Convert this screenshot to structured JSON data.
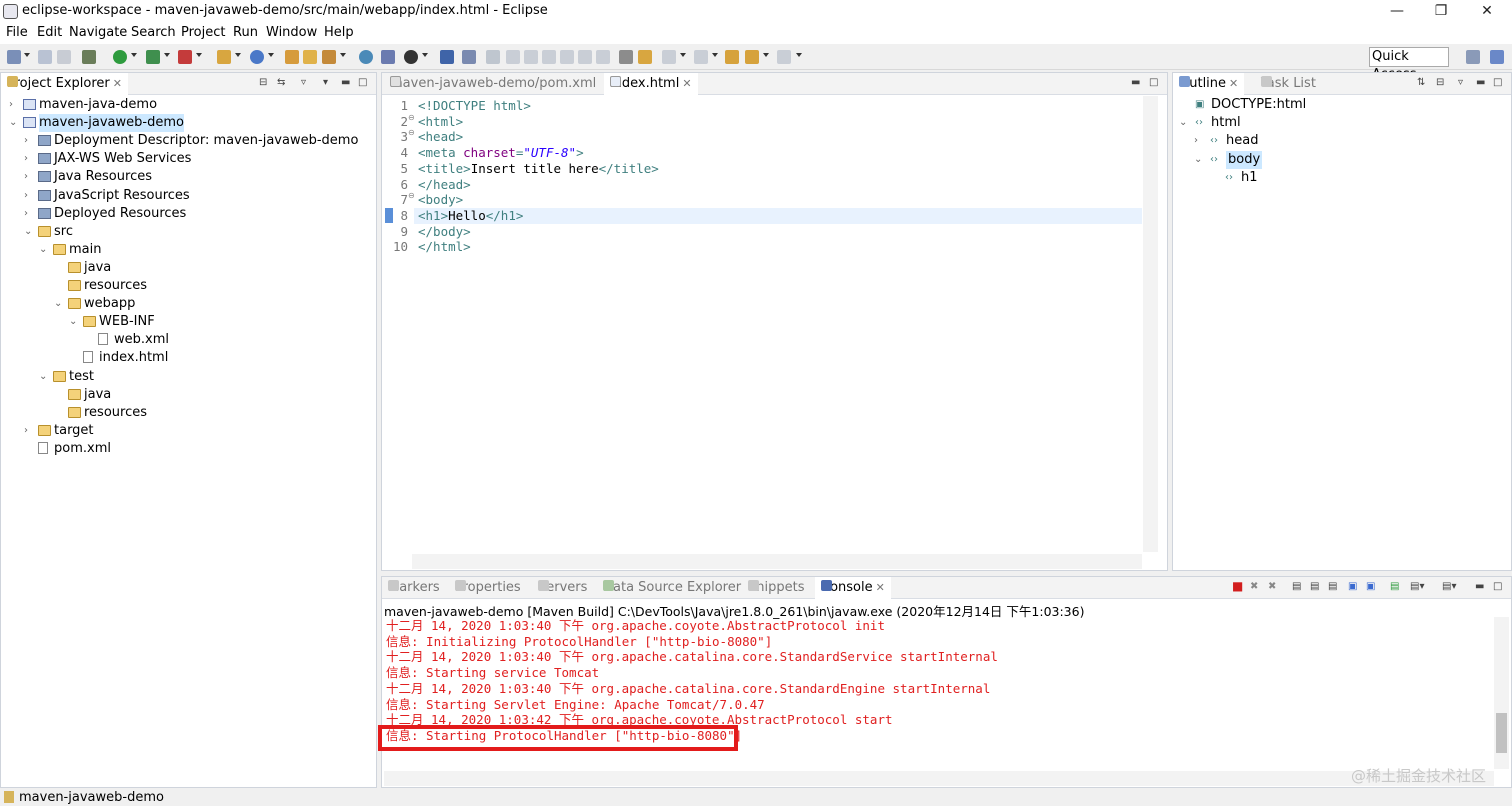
{
  "window": {
    "title": "eclipse-workspace - maven-javaweb-demo/src/main/webapp/index.html - Eclipse",
    "minimize": "—",
    "restore": "❐",
    "close": "✕"
  },
  "menu": [
    "File",
    "Edit",
    "Navigate",
    "Search",
    "Project",
    "Run",
    "Window",
    "Help"
  ],
  "toolbar": {
    "quick_access": "Quick Access"
  },
  "project_explorer": {
    "tab_label": "Project Explorer",
    "tree": [
      {
        "label": "maven-java-demo",
        "icon": "project-icon",
        "depth": 0,
        "twisty": "collapsed"
      },
      {
        "label": "maven-javaweb-demo",
        "icon": "project-icon",
        "depth": 0,
        "twisty": "expanded",
        "selected": true
      },
      {
        "label": "Deployment Descriptor: maven-javaweb-demo",
        "icon": "descriptor-icon",
        "depth": 1,
        "twisty": "collapsed"
      },
      {
        "label": "JAX-WS Web Services",
        "icon": "webservice-icon",
        "depth": 1,
        "twisty": "collapsed"
      },
      {
        "label": "Java Resources",
        "icon": "java-resources-icon",
        "depth": 1,
        "twisty": "collapsed"
      },
      {
        "label": "JavaScript Resources",
        "icon": "js-resources-icon",
        "depth": 1,
        "twisty": "collapsed"
      },
      {
        "label": "Deployed Resources",
        "icon": "deployed-resources-icon",
        "depth": 1,
        "twisty": "collapsed"
      },
      {
        "label": "src",
        "icon": "folder-icon",
        "depth": 1,
        "twisty": "expanded"
      },
      {
        "label": "main",
        "icon": "folder-icon",
        "depth": 2,
        "twisty": "expanded"
      },
      {
        "label": "java",
        "icon": "folder-icon",
        "depth": 3,
        "twisty": "none"
      },
      {
        "label": "resources",
        "icon": "folder-icon",
        "depth": 3,
        "twisty": "none"
      },
      {
        "label": "webapp",
        "icon": "folder-icon",
        "depth": 3,
        "twisty": "expanded"
      },
      {
        "label": "WEB-INF",
        "icon": "folder-icon",
        "depth": 4,
        "twisty": "expanded"
      },
      {
        "label": "web.xml",
        "icon": "xml-file-icon",
        "depth": 5,
        "twisty": "none"
      },
      {
        "label": "index.html",
        "icon": "html-file-icon",
        "depth": 4,
        "twisty": "none"
      },
      {
        "label": "test",
        "icon": "folder-icon",
        "depth": 2,
        "twisty": "expanded"
      },
      {
        "label": "java",
        "icon": "folder-icon",
        "depth": 3,
        "twisty": "none"
      },
      {
        "label": "resources",
        "icon": "folder-icon",
        "depth": 3,
        "twisty": "none"
      },
      {
        "label": "target",
        "icon": "folder-icon",
        "depth": 1,
        "twisty": "collapsed"
      },
      {
        "label": "pom.xml",
        "icon": "xml-file-icon",
        "depth": 1,
        "twisty": "none"
      }
    ]
  },
  "editor": {
    "tabs": [
      {
        "label": "maven-javaweb-demo/pom.xml",
        "active": false
      },
      {
        "label": "index.html",
        "active": true
      }
    ],
    "lines": [
      {
        "n": "1",
        "fold": "",
        "parts": [
          [
            "tag",
            "<!DOCTYPE html>"
          ]
        ]
      },
      {
        "n": "2",
        "fold": "⊖",
        "parts": [
          [
            "tag",
            "<html>"
          ]
        ]
      },
      {
        "n": "3",
        "fold": "⊖",
        "parts": [
          [
            "tag",
            "<head>"
          ]
        ]
      },
      {
        "n": "4",
        "fold": "",
        "parts": [
          [
            "tag",
            "<meta "
          ],
          [
            "attr",
            "charset"
          ],
          [
            "tag",
            "="
          ],
          [
            "val",
            "\"UTF-8\""
          ],
          [
            "tag",
            ">"
          ]
        ]
      },
      {
        "n": "5",
        "fold": "",
        "parts": [
          [
            "tag",
            "<title>"
          ],
          [
            "txt",
            "Insert title here"
          ],
          [
            "tag",
            "</title>"
          ]
        ]
      },
      {
        "n": "6",
        "fold": "",
        "parts": [
          [
            "tag",
            "</head>"
          ]
        ]
      },
      {
        "n": "7",
        "fold": "⊖",
        "parts": [
          [
            "tag",
            "<body>"
          ]
        ]
      },
      {
        "n": "8",
        "fold": "",
        "parts": [
          [
            "tag",
            "<h1>"
          ],
          [
            "txt",
            "Hello"
          ],
          [
            "tag",
            "</h1>"
          ]
        ],
        "current": true
      },
      {
        "n": "9",
        "fold": "",
        "parts": [
          [
            "tag",
            "</body>"
          ]
        ]
      },
      {
        "n": "10",
        "fold": "",
        "parts": [
          [
            "tag",
            "</html>"
          ]
        ]
      }
    ]
  },
  "outline": {
    "tabs": [
      {
        "label": "Outline",
        "active": true
      },
      {
        "label": "Task List",
        "active": false
      }
    ],
    "tree": [
      {
        "label": "DOCTYPE:html",
        "depth": 0,
        "twisty": "none"
      },
      {
        "label": "html",
        "depth": 0,
        "twisty": "expanded"
      },
      {
        "label": "head",
        "depth": 1,
        "twisty": "collapsed"
      },
      {
        "label": "body",
        "depth": 1,
        "twisty": "expanded",
        "selected": true
      },
      {
        "label": "h1",
        "depth": 2,
        "twisty": "none"
      }
    ]
  },
  "bottom_panel": {
    "tabs": [
      {
        "label": "Markers",
        "active": false
      },
      {
        "label": "Properties",
        "active": false
      },
      {
        "label": "Servers",
        "active": false
      },
      {
        "label": "Data Source Explorer",
        "active": false
      },
      {
        "label": "Snippets",
        "active": false
      },
      {
        "label": "Console",
        "active": true
      }
    ],
    "console_header": "maven-javaweb-demo [Maven Build] C:\\DevTools\\Java\\jre1.8.0_261\\bin\\javaw.exe (2020年12月14日 下午1:03:36)",
    "console_lines": [
      "十二月 14, 2020 1:03:40 下午 org.apache.coyote.AbstractProtocol init",
      "信息: Initializing ProtocolHandler [\"http-bio-8080\"]",
      "十二月 14, 2020 1:03:40 下午 org.apache.catalina.core.StandardService startInternal",
      "信息: Starting service Tomcat",
      "十二月 14, 2020 1:03:40 下午 org.apache.catalina.core.StandardEngine startInternal",
      "信息: Starting Servlet Engine: Apache Tomcat/7.0.47",
      "十二月 14, 2020 1:03:42 下午 org.apache.coyote.AbstractProtocol start",
      "信息: Starting ProtocolHandler [\"http-bio-8080\"]"
    ]
  },
  "status": {
    "selection": "maven-javaweb-demo"
  },
  "watermark": "@稀土掘金技术社区",
  "colors": {
    "console_text": "#e02020",
    "highlight_box": "#e31b1b",
    "selection": "#cce8ff",
    "tag": "#3f7f7f"
  }
}
